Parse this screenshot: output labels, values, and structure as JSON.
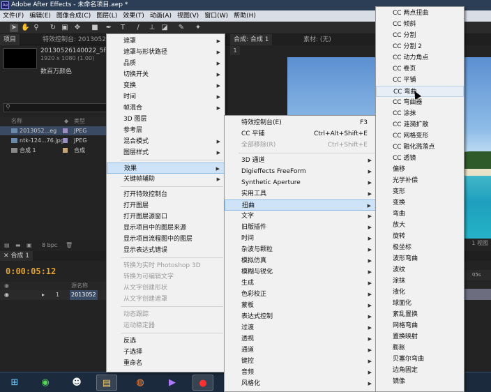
{
  "window": {
    "title": "Adobe After Effects - 未命名项目.aep *",
    "app_icon": "Ae"
  },
  "menubar": [
    "文件(F)",
    "编辑(E)",
    "图像合成(C)",
    "图层(L)",
    "效果(T)",
    "动画(A)",
    "视图(V)",
    "窗口(W)",
    "帮助(H)"
  ],
  "toolbar_icons": [
    "select-tool-icon",
    "hand-tool-icon",
    "zoom-tool-icon",
    "rotate-tool-icon",
    "camera-tool-icon",
    "pan-behind-icon",
    "rect-mask-icon",
    "pen-tool-icon",
    "type-tool-icon",
    "brush-tool-icon",
    "clone-stamp-icon",
    "eraser-icon",
    "roto-brush-icon",
    "puppet-pin-icon"
  ],
  "project_panel": {
    "tab_project": "项目",
    "tab_effects": "特效控制台: 2013052",
    "item_name": "20130526140022_5fM",
    "item_dims": "1920 x 1080 (1.00)",
    "item_colors": "数百万颜色",
    "col_name": "名称",
    "col_type": "类型",
    "rows": [
      {
        "name": "2013052...eg",
        "type": "JPEG",
        "color": "#9a8fc0"
      },
      {
        "name": "ntk-124...76.jpg",
        "type": "JPEG",
        "color": "#9a8fc0"
      },
      {
        "name": "合成 1",
        "type": "合成",
        "color": "#c8a47a"
      }
    ],
    "bpc": "8 bpc"
  },
  "comp_panel": {
    "tab_comp": "合成: 合成 1",
    "tab_footage": "素材: (无)",
    "subtab": "1",
    "view_label": "1 视图"
  },
  "timeline": {
    "tab": "合成 1",
    "timecode": "0:00:05:12",
    "col_source": "源名称",
    "layer_index": "1",
    "layer_name": "2013052",
    "ruler_label": "05s"
  },
  "menu_layer": {
    "items": [
      {
        "label": "遮罩",
        "sub": true
      },
      {
        "label": "遮罩与形状路径",
        "sub": true
      },
      {
        "label": "品质",
        "sub": true
      },
      {
        "label": "切换开关",
        "sub": true
      },
      {
        "label": "变换",
        "sub": true
      },
      {
        "label": "时间",
        "sub": true
      },
      {
        "label": "帧混合",
        "sub": true
      },
      {
        "label": "3D 图层",
        "sub": false
      },
      {
        "label": "参考层",
        "sub": false
      },
      {
        "label": "混合模式",
        "sub": true
      },
      {
        "label": "图层样式",
        "sub": true
      },
      {
        "label": "效果",
        "sub": true,
        "state": "highlight"
      },
      {
        "label": "关键帧辅助",
        "sub": true
      },
      {
        "label": "打开特效控制台",
        "sub": false
      },
      {
        "label": "打开图层",
        "sub": false
      },
      {
        "label": "打开图层源窗口",
        "sub": false
      },
      {
        "label": "显示项目中的图层来源",
        "sub": false
      },
      {
        "label": "显示项目流程图中的图层",
        "sub": false
      },
      {
        "label": "显示表达式错误",
        "sub": false
      },
      {
        "label": "转换为实时 Photoshop 3D",
        "sub": false,
        "disabled": true
      },
      {
        "label": "转换为可编辑文字",
        "sub": false,
        "disabled": true
      },
      {
        "label": "从文字创建形状",
        "sub": false,
        "disabled": true
      },
      {
        "label": "从文字创建遮罩",
        "sub": false,
        "disabled": true
      },
      {
        "label": "动态跟踪",
        "sub": false,
        "disabled": true
      },
      {
        "label": "运动稳定器",
        "sub": false,
        "disabled": true
      },
      {
        "label": "反选",
        "sub": false
      },
      {
        "label": "子选择",
        "sub": false
      },
      {
        "label": "重命名",
        "sub": false
      }
    ]
  },
  "menu_effect": {
    "items": [
      {
        "label": "特效控制台(E)",
        "shortcut": "F3"
      },
      {
        "label": "CC 平铺",
        "shortcut": "Ctrl+Alt+Shift+E"
      },
      {
        "label": "全部移除(R)",
        "shortcut": "Ctrl+Shift+E",
        "disabled": true
      },
      {
        "label": "3D 通道",
        "sub": true
      },
      {
        "label": "Digieffects FreeForm",
        "sub": true
      },
      {
        "label": "Synthetic Aperture",
        "sub": true
      },
      {
        "label": "实用工具",
        "sub": true
      },
      {
        "label": "扭曲",
        "sub": true,
        "state": "highlight"
      },
      {
        "label": "文字",
        "sub": true
      },
      {
        "label": "旧版插件",
        "sub": true
      },
      {
        "label": "时间",
        "sub": true
      },
      {
        "label": "杂波与颗粒",
        "sub": true
      },
      {
        "label": "模拟仿真",
        "sub": true
      },
      {
        "label": "模糊与锐化",
        "sub": true
      },
      {
        "label": "生成",
        "sub": true
      },
      {
        "label": "色彩校正",
        "sub": true
      },
      {
        "label": "蒙板",
        "sub": true
      },
      {
        "label": "表达式控制",
        "sub": true
      },
      {
        "label": "过渡",
        "sub": true
      },
      {
        "label": "透视",
        "sub": true
      },
      {
        "label": "通道",
        "sub": true
      },
      {
        "label": "键控",
        "sub": true
      },
      {
        "label": "音频",
        "sub": true
      },
      {
        "label": "风格化",
        "sub": true
      }
    ]
  },
  "menu_distort": {
    "items": [
      "CC 两点扭曲",
      "CC 倾斜",
      "CC 分割",
      "CC 分割 2",
      "CC 动力角点",
      "CC 卷页",
      "CC 平铺",
      "CC 弯曲",
      "CC 弯曲器",
      "CC 涂抹",
      "CC 涟漪扩散",
      "CC 网格变形",
      "CC 融化溅落点",
      "CC 透镜",
      "偏移",
      "光学补偿",
      "变形",
      "变换",
      "弯曲",
      "放大",
      "旋转",
      "极坐标",
      "波形弯曲",
      "波纹",
      "涂抹",
      "液化",
      "球面化",
      "紊乱置换",
      "网格弯曲",
      "置换映射",
      "膨胀",
      "贝塞尔弯曲",
      "边角固定",
      "镜像"
    ],
    "hover_index": 7
  },
  "taskbar": [
    "windows-start-icon",
    "360-browser-icon",
    "qq-penguin-icon",
    "file-explorer-icon",
    "firefox-icon",
    "media-player-icon",
    "record-icon"
  ],
  "colors": {
    "accent": "#e3a42d",
    "menu_highlight": "#cfe3f8",
    "titlebar": "#2c3e55"
  }
}
